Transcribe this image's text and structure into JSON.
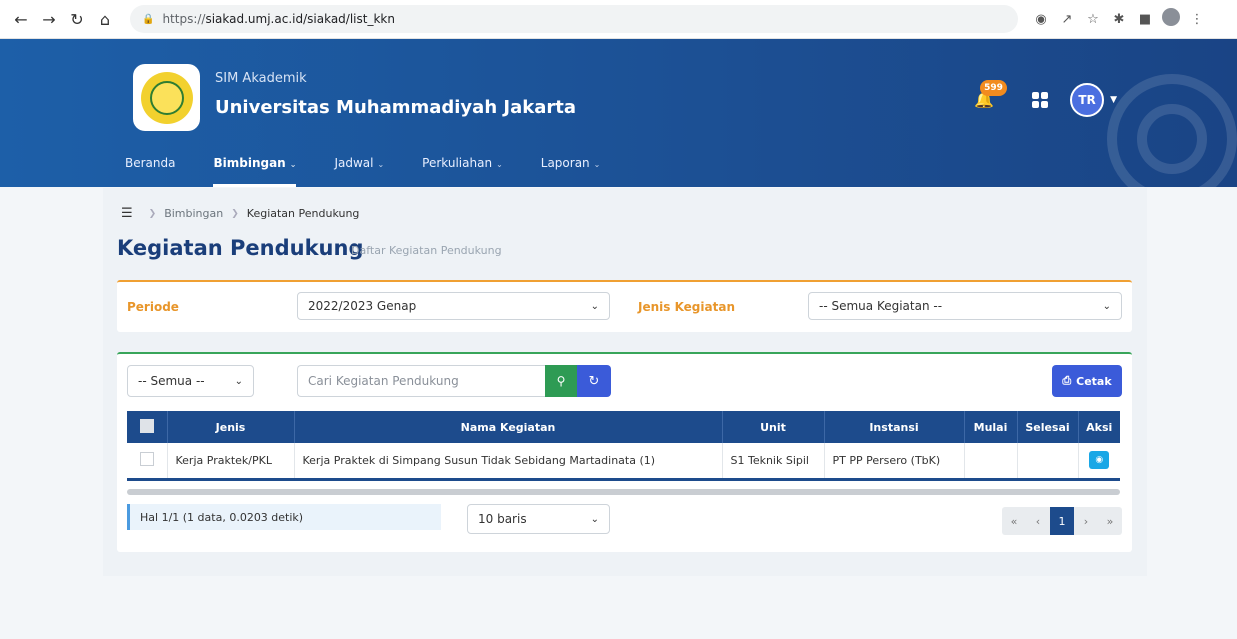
{
  "browser": {
    "url_proto": "https://",
    "url_rest": "siakad.umj.ac.id/siakad/list_kkn"
  },
  "header": {
    "subtitle": "SIM Akademik",
    "title": "Universitas Muhammadiyah Jakarta",
    "notif_count": "599",
    "avatar_initials": "TR"
  },
  "nav": [
    {
      "label": "Beranda"
    },
    {
      "label": "Bimbingan"
    },
    {
      "label": "Jadwal"
    },
    {
      "label": "Perkuliahan"
    },
    {
      "label": "Laporan"
    }
  ],
  "breadcrumb": {
    "parent": "Bimbingan",
    "current": "Kegiatan Pendukung"
  },
  "page": {
    "title": "Kegiatan Pendukung",
    "subtitle": "Daftar Kegiatan Pendukung"
  },
  "filters": {
    "periode_label": "Periode",
    "periode_value": "2022/2023 Genap",
    "jenis_label": "Jenis Kegiatan",
    "jenis_value": "-- Semua Kegiatan --"
  },
  "toolbar": {
    "scope_value": "-- Semua --",
    "search_placeholder": "Cari Kegiatan Pendukung",
    "print_label": "Cetak"
  },
  "table": {
    "headers": [
      "Jenis",
      "Nama Kegiatan",
      "Unit",
      "Instansi",
      "Mulai",
      "Selesai",
      "Aksi"
    ],
    "rows": [
      {
        "jenis": "Kerja Praktek/PKL",
        "nama": "Kerja Praktek di Simpang Susun Tidak Sebidang Martadinata (1)",
        "unit": "S1 Teknik Sipil",
        "instansi": "PT PP Persero (TbK)",
        "mulai": "",
        "selesai": ""
      }
    ]
  },
  "footer": {
    "info": "Hal 1/1 (1 data, 0.0203 detik)",
    "rows_value": "10 baris",
    "current_page": "1"
  },
  "colors": {
    "header_blue": "#1d5fa8",
    "table_head": "#1d4b8c",
    "accent_orange": "#e8962b",
    "accent_green": "#38a55a",
    "button_blue": "#3b5bd9"
  }
}
